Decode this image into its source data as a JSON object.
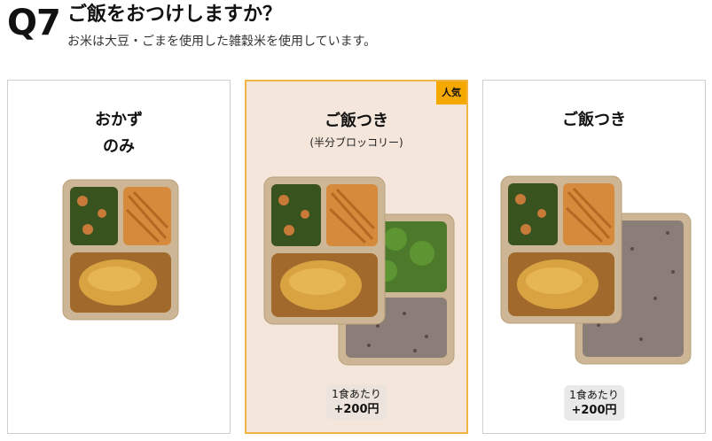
{
  "question": {
    "number": "Q7",
    "title": "ご飯をおつけしますか？",
    "subtitle": "お米は大豆・ごまを使用した雑穀米を使用しています。"
  },
  "options": [
    {
      "title_line1": "おかず",
      "title_line2": "のみ",
      "subtitle": "",
      "badge": "",
      "price_label": "",
      "price_value": "",
      "selected": false
    },
    {
      "title_line1": "ご飯つき",
      "title_line2": "",
      "subtitle": "(半分ブロッコリー)",
      "badge": "人気",
      "price_label": "1食あたり",
      "price_value": "+200円",
      "selected": true
    },
    {
      "title_line1": "ご飯つき",
      "title_line2": "",
      "subtitle": "",
      "badge": "",
      "price_label": "1食あたり",
      "price_value": "+200円",
      "selected": false
    }
  ],
  "colors": {
    "badge": "#f5a800",
    "selected_border": "#f2b544",
    "selected_bg": "#f4e6da"
  }
}
